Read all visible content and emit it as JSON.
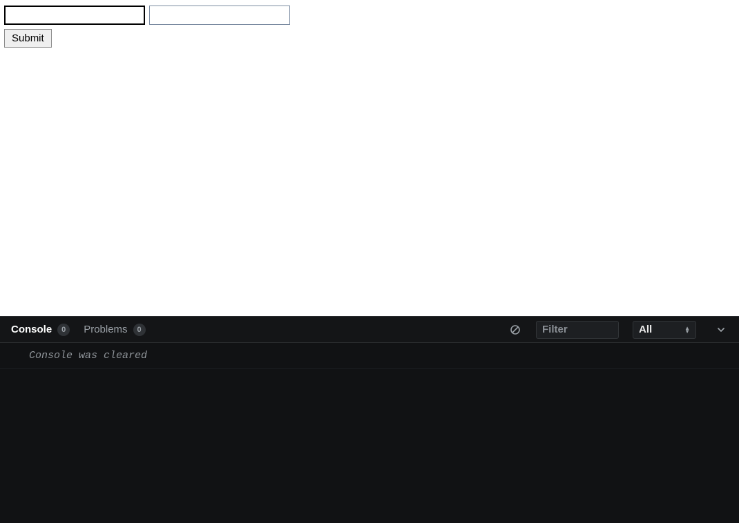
{
  "page": {
    "input1_value": "",
    "input2_value": "",
    "submit_label": "Submit"
  },
  "devtools": {
    "tabs": {
      "console_label": "Console",
      "console_count": "0",
      "problems_label": "Problems",
      "problems_count": "0"
    },
    "filter_placeholder": "Filter",
    "level_selected": "All",
    "messages": [
      "Console was cleared"
    ]
  }
}
